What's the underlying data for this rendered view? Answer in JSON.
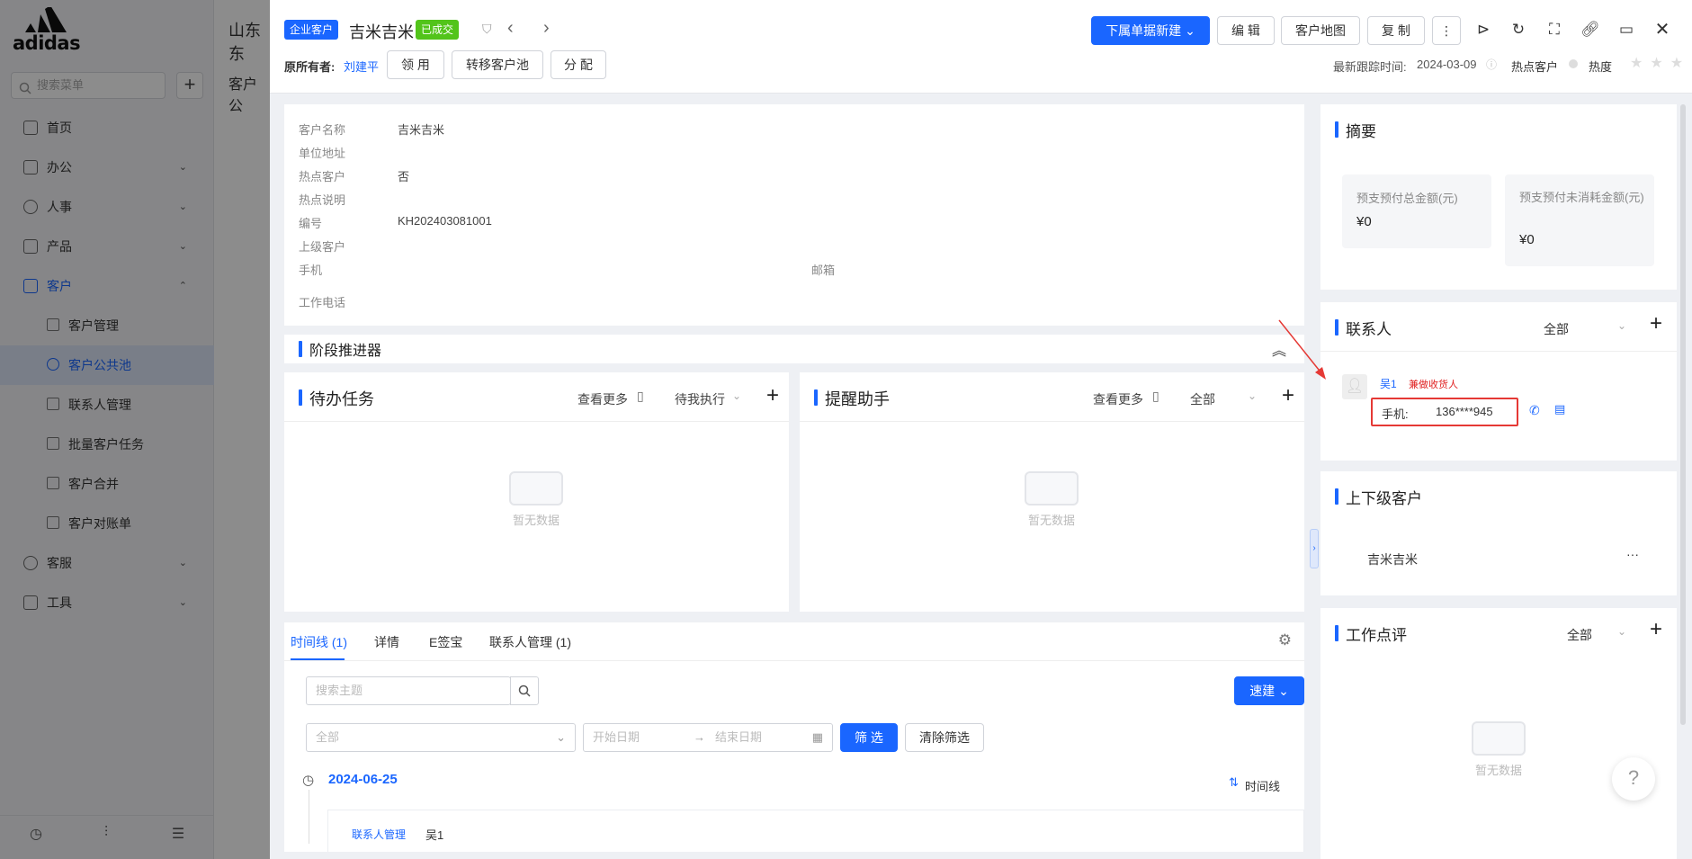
{
  "sidebar": {
    "logo_text": "adidas",
    "search_placeholder": "搜索菜单",
    "add_label": "+",
    "menu": [
      {
        "label": "首页",
        "arrow": ""
      },
      {
        "label": "办公",
        "arrow": "⌄"
      },
      {
        "label": "人事",
        "arrow": "⌄"
      },
      {
        "label": "产品",
        "arrow": "⌄"
      },
      {
        "label": "客户",
        "arrow": "⌃"
      }
    ],
    "submenu": [
      "客户管理",
      "客户公共池",
      "联系人管理",
      "批量客户任务",
      "客户合并",
      "客户对账单"
    ],
    "menu2": [
      {
        "label": "客服",
        "arrow": "⌄"
      },
      {
        "label": "工具",
        "arrow": "⌄"
      }
    ]
  },
  "background": {
    "company_title": "山东东",
    "section_title": "客户公"
  },
  "header": {
    "type_tag": "企业客户",
    "customer_name": "吉米吉米",
    "status_tag": "已成交",
    "owner_label": "原所有者:",
    "owner_name": "刘建平",
    "claim_btn": "领 用",
    "transfer_btn": "转移客户池",
    "assign_btn": "分 配",
    "new_sub_btn": "下属单据新建",
    "edit_btn": "编 辑",
    "map_btn": "客户地图",
    "copy_btn": "复 制",
    "last_follow_label": "最新跟踪时间:",
    "last_follow_date": "2024-03-09",
    "hot_label": "热点客户",
    "heat_label": "热度"
  },
  "info": {
    "fields": [
      {
        "label": "客户名称",
        "value": "吉米吉米"
      },
      {
        "label": "单位地址",
        "value": ""
      },
      {
        "label": "热点客户",
        "value": "否"
      },
      {
        "label": "热点说明",
        "value": ""
      },
      {
        "label": "编号",
        "value": "KH202403081001"
      },
      {
        "label": "上级客户",
        "value": ""
      },
      {
        "label": "手机",
        "value": ""
      }
    ],
    "email_label": "邮箱",
    "work_phone_label": "工作电话"
  },
  "stage": {
    "title": "阶段推进器"
  },
  "todo": {
    "title": "待办任务",
    "more": "查看更多",
    "filter": "待我执行",
    "empty": "暂无数据"
  },
  "reminder": {
    "title": "提醒助手",
    "more": "查看更多",
    "filter": "全部",
    "empty": "暂无数据"
  },
  "tabs": {
    "items": [
      "时间线 (1)",
      "详情",
      "E签宝",
      "联系人管理 (1)"
    ],
    "search_placeholder": "搜索主题",
    "quick_new": "速建",
    "select_placeholder": "全部",
    "start_date": "开始日期",
    "end_date": "结束日期",
    "filter_btn": "筛 选",
    "clear_btn": "清除筛选",
    "timeline_date": "2024-06-25",
    "timeline_toggle": "时间线",
    "entry_tag": "联系人管理",
    "entry_name": "吴1"
  },
  "summary": {
    "title": "摘要",
    "items": [
      {
        "label": "预支预付总金额(元)",
        "value": "¥0"
      },
      {
        "label": "预支预付未消耗金额(元)",
        "value": "¥0"
      }
    ]
  },
  "contacts": {
    "title": "联系人",
    "filter": "全部",
    "name": "吴1",
    "role": "兼做收货人",
    "phone_label": "手机:",
    "phone_value": "136****945"
  },
  "hierarchy": {
    "title": "上下级客户",
    "item": "吉米吉米",
    "more": "···"
  },
  "review": {
    "title": "工作点评",
    "filter": "全部",
    "empty": "暂无数据"
  },
  "help": {
    "label": "?"
  }
}
